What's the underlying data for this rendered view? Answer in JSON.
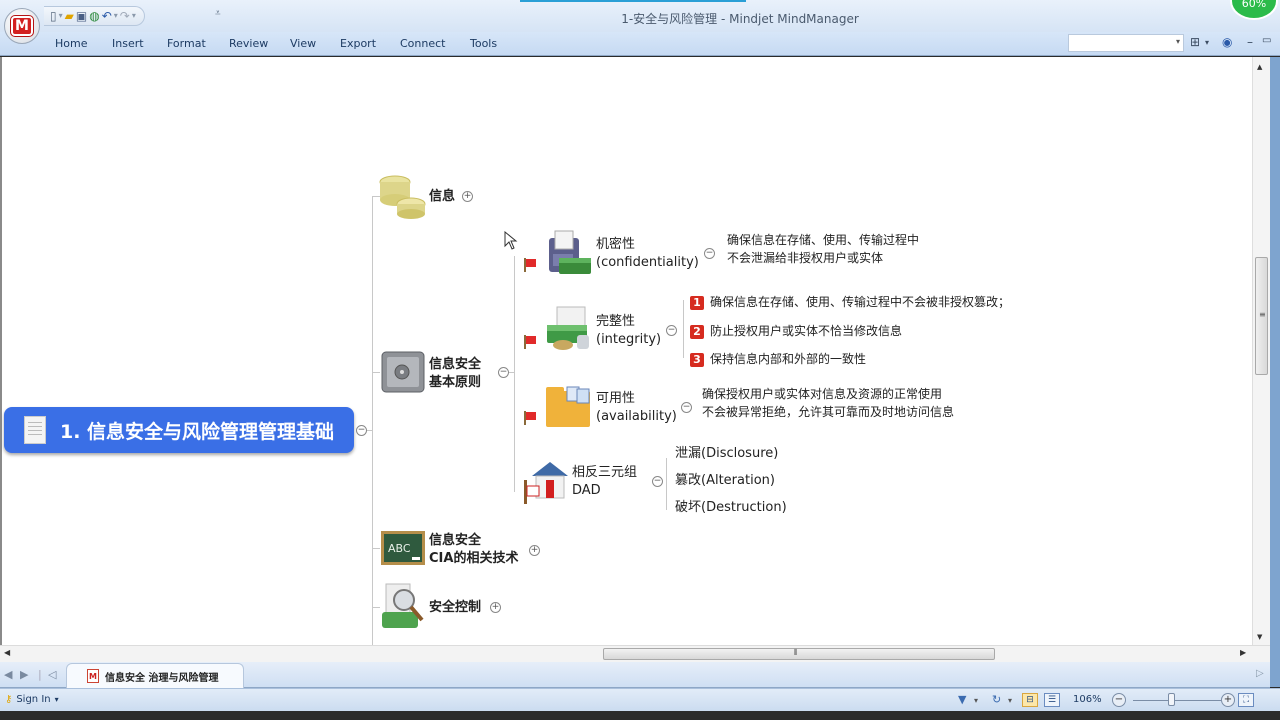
{
  "window": {
    "title": "1-安全与风险管理 - Mindjet MindManager",
    "progress_badge": "60%"
  },
  "quick_access": {
    "icons": [
      "new-icon",
      "open-icon",
      "save-icon",
      "save-online-icon",
      "undo-icon",
      "redo-icon",
      "customize-icon"
    ]
  },
  "ribbon": {
    "tabs": [
      "Home",
      "Insert",
      "Format",
      "Review",
      "View",
      "Export",
      "Connect",
      "Tools"
    ],
    "search_value": ""
  },
  "map": {
    "central_topic": "1. 信息安全与风险管理管理基础",
    "main_topics": [
      {
        "label": "信息",
        "icon": "coins-icon",
        "state": "collapsed"
      },
      {
        "label_line1": "信息安全",
        "label_line2": "基本原则",
        "icon": "safe-icon",
        "state": "expanded"
      },
      {
        "label_line1": "信息安全",
        "label_line2": "CIA的相关技术",
        "icon": "chalkboard-icon",
        "state": "collapsed"
      },
      {
        "label": "安全控制",
        "icon": "magnifier-icon",
        "state": "collapsed"
      }
    ],
    "subtopics": [
      {
        "label_line1": "机密性",
        "label_line2": "(confidentiality)",
        "icon": "fax-icon",
        "flag": "red-flag",
        "notes": [
          "确保信息在存储、使用、传输过程中",
          "不会泄漏给非授权用户或实体"
        ]
      },
      {
        "label_line1": "完整性",
        "label_line2": "(integrity)",
        "icon": "money-icon",
        "flag": "red-flag",
        "items": [
          {
            "num": "1",
            "text": "确保信息在存储、使用、传输过程中不会被非授权篡改；"
          },
          {
            "num": "2",
            "text": "防止授权用户或实体不恰当修改信息"
          },
          {
            "num": "3",
            "text": "保持信息内部和外部的一致性"
          }
        ]
      },
      {
        "label_line1": "可用性",
        "label_line2": "(availability)",
        "icon": "folder-icon",
        "flag": "red-flag",
        "notes": [
          "确保授权用户或实体对信息及资源的正常使用",
          "不会被异常拒绝，允许其可靠而及时地访问信息"
        ]
      },
      {
        "label_line1": "相反三元组",
        "label_line2": "DAD",
        "icon": "house-icon",
        "items": [
          "泄漏(Disclosure)",
          "篡改(Alteration)",
          "破坏(Destruction)"
        ]
      }
    ]
  },
  "document_tabs": [
    {
      "label": "信息安全 治理与风险管理",
      "active": true
    }
  ],
  "status_bar": {
    "sign_in": "Sign In",
    "zoom_level": "106%",
    "zoom_fraction": 0.43
  }
}
